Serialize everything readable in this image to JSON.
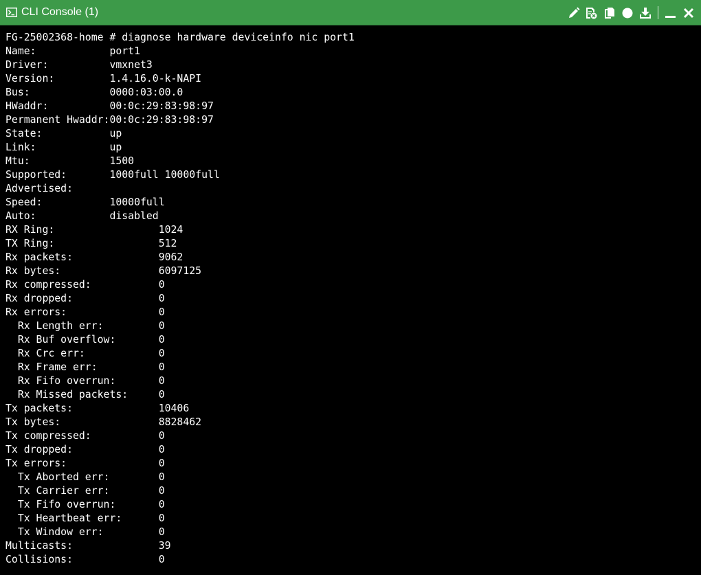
{
  "window": {
    "title": "CLI Console (1)"
  },
  "toolbar": {
    "icons": [
      "edit-icon",
      "clear-icon",
      "copy-icon",
      "record-icon",
      "download-icon",
      "minimize-icon",
      "close-icon"
    ],
    "color": "#ffffff",
    "titlebar_color": "#3d9a49"
  },
  "console": {
    "prompt": "FG-25002368-home # ",
    "command": "diagnose hardware deviceinfo nic port1",
    "lines": [
      {
        "label": "Name:",
        "value": "port1",
        "col": 17
      },
      {
        "label": "Driver:",
        "value": "vmxnet3",
        "col": 17
      },
      {
        "label": "Version:",
        "value": "1.4.16.0-k-NAPI",
        "col": 17
      },
      {
        "label": "Bus:",
        "value": "0000:03:00.0",
        "col": 17
      },
      {
        "label": "HWaddr:",
        "value": "00:0c:29:83:98:97",
        "col": 17
      },
      {
        "label": "Permanent Hwaddr:",
        "value": "00:0c:29:83:98:97",
        "col": 17
      },
      {
        "label": "State:",
        "value": "up",
        "col": 17
      },
      {
        "label": "Link:",
        "value": "up",
        "col": 17
      },
      {
        "label": "Mtu:",
        "value": "1500",
        "col": 17
      },
      {
        "label": "Supported:",
        "value": "1000full 10000full",
        "col": 17
      },
      {
        "label": "Advertised:",
        "value": "",
        "col": 17
      },
      {
        "label": "Speed:",
        "value": "10000full",
        "col": 17
      },
      {
        "label": "Auto:",
        "value": "disabled",
        "col": 17
      },
      {
        "label": "RX Ring:",
        "value": "1024",
        "col": 25
      },
      {
        "label": "TX Ring:",
        "value": "512",
        "col": 25
      },
      {
        "label": "Rx packets:",
        "value": "9062",
        "col": 25
      },
      {
        "label": "Rx bytes:",
        "value": "6097125",
        "col": 25
      },
      {
        "label": "Rx compressed:",
        "value": "0",
        "col": 25
      },
      {
        "label": "Rx dropped:",
        "value": "0",
        "col": 25
      },
      {
        "label": "Rx errors:",
        "value": "0",
        "col": 25
      },
      {
        "label": "  Rx Length err:",
        "value": "0",
        "col": 25
      },
      {
        "label": "  Rx Buf overflow:",
        "value": "0",
        "col": 25
      },
      {
        "label": "  Rx Crc err:",
        "value": "0",
        "col": 25
      },
      {
        "label": "  Rx Frame err:",
        "value": "0",
        "col": 25
      },
      {
        "label": "  Rx Fifo overrun:",
        "value": "0",
        "col": 25
      },
      {
        "label": "  Rx Missed packets:",
        "value": "0",
        "col": 25
      },
      {
        "label": "Tx packets:",
        "value": "10406",
        "col": 25
      },
      {
        "label": "Tx bytes:",
        "value": "8828462",
        "col": 25
      },
      {
        "label": "Tx compressed:",
        "value": "0",
        "col": 25
      },
      {
        "label": "Tx dropped:",
        "value": "0",
        "col": 25
      },
      {
        "label": "Tx errors:",
        "value": "0",
        "col": 25
      },
      {
        "label": "  Tx Aborted err:",
        "value": "0",
        "col": 25
      },
      {
        "label": "  Tx Carrier err:",
        "value": "0",
        "col": 25
      },
      {
        "label": "  Tx Fifo overrun:",
        "value": "0",
        "col": 25
      },
      {
        "label": "  Tx Heartbeat err:",
        "value": "0",
        "col": 25
      },
      {
        "label": "  Tx Window err:",
        "value": "0",
        "col": 25
      },
      {
        "label": "Multicasts:",
        "value": "39",
        "col": 25
      },
      {
        "label": "Collisions:",
        "value": "0",
        "col": 25
      }
    ]
  }
}
